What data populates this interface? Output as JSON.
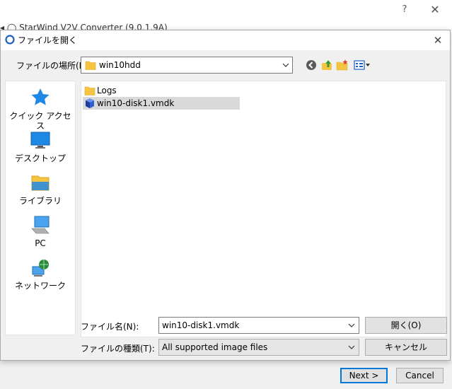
{
  "background_window": {
    "help_label": "?",
    "close_label": "✕",
    "title_fragment": "◂ ◯ StarWind V2V Converter (9.0.1.9A)",
    "next_label": "Next >",
    "cancel_label": "Cancel"
  },
  "dialog": {
    "title": "ファイルを開く",
    "close_label": "✕",
    "look_in_label": "ファイルの場所(I):",
    "look_in_value": "win10hdd",
    "places": [
      {
        "label": "クイック アクセス",
        "icon": "star-icon"
      },
      {
        "label": "デスクトップ",
        "icon": "desktop-icon"
      },
      {
        "label": "ライブラリ",
        "icon": "library-icon"
      },
      {
        "label": "PC",
        "icon": "pc-icon"
      },
      {
        "label": "ネットワーク",
        "icon": "network-icon"
      }
    ],
    "files": [
      {
        "name": "Logs",
        "icon": "folder-icon",
        "selected": false
      },
      {
        "name": "win10-disk1.vmdk",
        "icon": "vmdk-file-icon",
        "selected": true
      }
    ],
    "file_name_label": "ファイル名(N):",
    "file_name_value": "win10-disk1.vmdk",
    "file_type_label": "ファイルの種類(T):",
    "file_type_value": "All supported image files",
    "open_label": "開く(O)",
    "cancel_label": "キャンセル"
  },
  "colors": {
    "dialog_bg": "#f0f0f0",
    "accent": "#0078d7",
    "selection": "#d9d9d9",
    "folder": "#f5c542"
  }
}
